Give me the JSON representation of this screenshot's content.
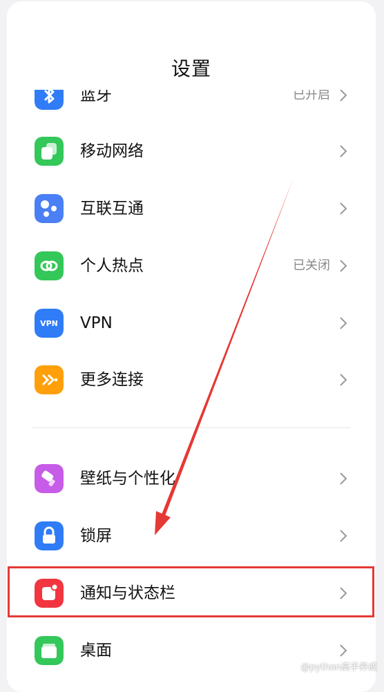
{
  "header": {
    "title": "设置"
  },
  "items": [
    {
      "label": "蓝牙",
      "value": "已开启",
      "icon": "bluetooth-icon",
      "color": "#2f7cf6"
    },
    {
      "label": "移动网络",
      "value": "",
      "icon": "mobile-network-icon",
      "color": "#34c759"
    },
    {
      "label": "互联互通",
      "value": "",
      "icon": "interconnect-icon",
      "color": "#4a7ff5"
    },
    {
      "label": "个人热点",
      "value": "已关闭",
      "icon": "hotspot-icon",
      "color": "#34c759"
    },
    {
      "label": "VPN",
      "value": "",
      "icon": "vpn-icon",
      "color": "#2f7cf6",
      "icon_text": "VPN"
    },
    {
      "label": "更多连接",
      "value": "",
      "icon": "more-connections-icon",
      "color": "#ff9f0a"
    },
    {
      "label": "壁纸与个性化",
      "value": "",
      "icon": "wallpaper-icon",
      "color": "#c75ce8"
    },
    {
      "label": "锁屏",
      "value": "",
      "icon": "lock-icon",
      "color": "#2f7cf6"
    },
    {
      "label": "通知与状态栏",
      "value": "",
      "icon": "notification-icon",
      "color": "#f2353f"
    },
    {
      "label": "桌面",
      "value": "",
      "icon": "desktop-icon",
      "color": "#34c759"
    }
  ],
  "annotation": {
    "highlight_color": "#e53935"
  },
  "watermark": "@python高手养成"
}
